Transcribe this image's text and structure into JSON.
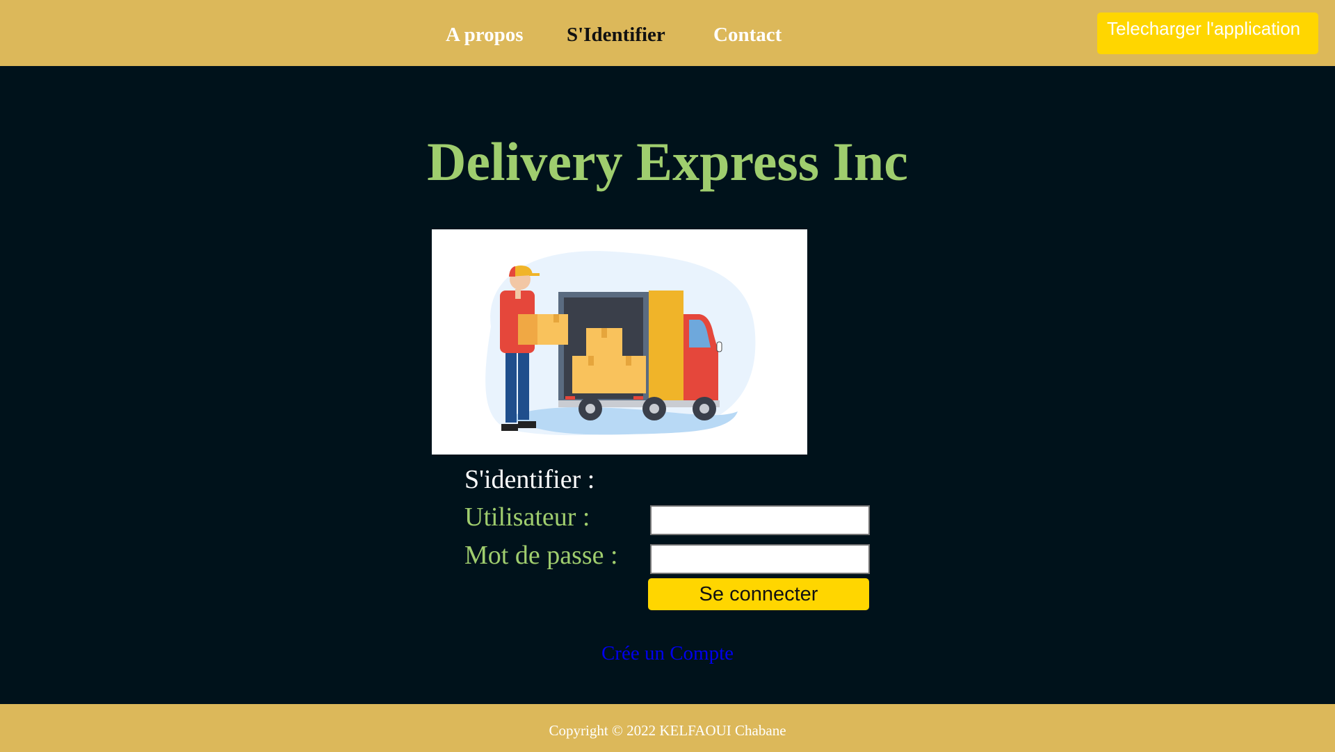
{
  "header": {
    "nav": [
      {
        "label": "A propos"
      },
      {
        "label": "S'Identifier"
      },
      {
        "label": "Contact"
      }
    ],
    "download_label": "Telecharger l'application"
  },
  "main": {
    "title": "Delivery Express Inc",
    "illustration": "delivery-truck-illustration",
    "form": {
      "heading": "S'identifier :",
      "username_label": "Utilisateur :",
      "username_value": "",
      "password_label": "Mot de passe :",
      "password_value": "",
      "submit_label": "Se connecter"
    },
    "create_account_label": "Crée un Compte"
  },
  "footer": {
    "copyright": "Copyright © 2022 KELFAOUI Chabane"
  },
  "colors": {
    "header_bg": "#dcb85a",
    "page_bg": "#00121b",
    "accent_green": "#9fcd6e",
    "button_yellow": "#ffd600",
    "link_blue": "#0000ee"
  }
}
